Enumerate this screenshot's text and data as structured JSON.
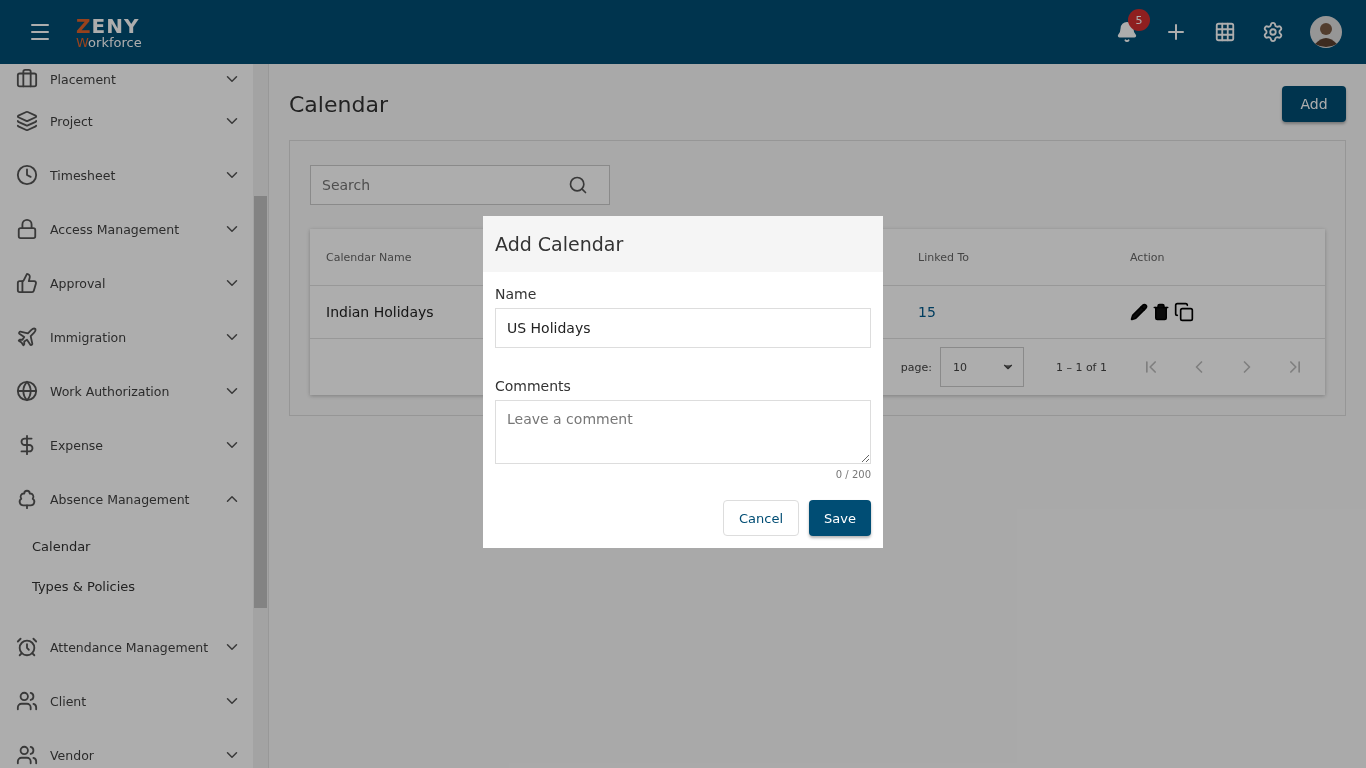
{
  "header": {
    "logo_top": "ZENY",
    "logo_bottom": "Workforce",
    "notification_count": "5"
  },
  "sidebar": {
    "items": [
      {
        "label": "Placement",
        "expanded": false
      },
      {
        "label": "Project",
        "expanded": false
      },
      {
        "label": "Timesheet",
        "expanded": false
      },
      {
        "label": "Access Management",
        "expanded": false
      },
      {
        "label": "Approval",
        "expanded": false
      },
      {
        "label": "Immigration",
        "expanded": false
      },
      {
        "label": "Work Authorization",
        "expanded": false
      },
      {
        "label": "Expense",
        "expanded": false
      },
      {
        "label": "Absence Management",
        "expanded": true,
        "children": [
          {
            "label": "Calendar"
          },
          {
            "label": "Types & Policies"
          }
        ]
      },
      {
        "label": "Attendance Management",
        "expanded": false
      },
      {
        "label": "Client",
        "expanded": false
      },
      {
        "label": "Vendor",
        "expanded": false
      }
    ]
  },
  "page": {
    "title": "Calendar",
    "add_button": "Add",
    "search": {
      "placeholder": "Search"
    },
    "table": {
      "columns": [
        "Calendar Name",
        "Linked To",
        "Action"
      ],
      "rows": [
        {
          "name": "Indian Holidays",
          "linked_to": "15"
        }
      ]
    },
    "paginator": {
      "label": "page:",
      "page_size": "10",
      "range": "1 – 1 of 1"
    }
  },
  "dialog": {
    "title": "Add Calendar",
    "name_label": "Name",
    "name_value": "US Holidays",
    "comments_label": "Comments",
    "comments_placeholder": "Leave a comment",
    "counter": "0 / 200",
    "cancel": "Cancel",
    "save": "Save"
  }
}
